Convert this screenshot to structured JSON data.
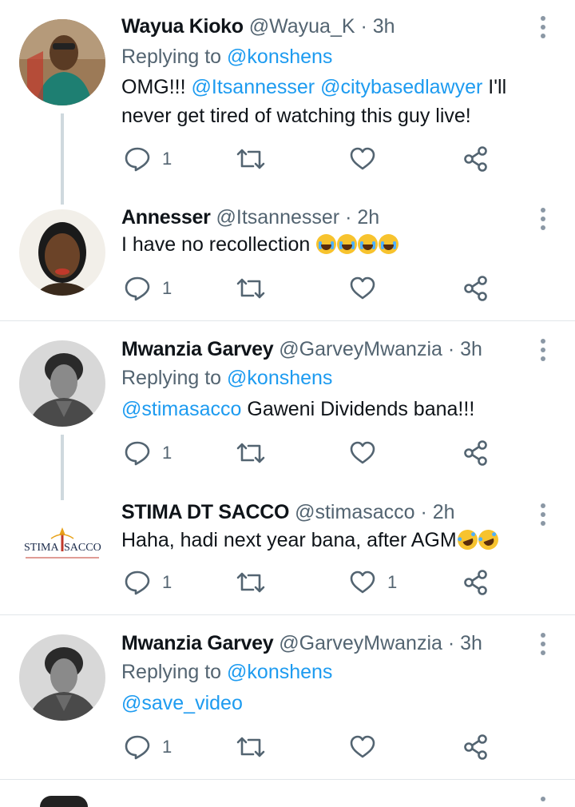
{
  "tweets": [
    {
      "name": "Wayua Kioko",
      "handle": "@Wayua_K",
      "dot": "·",
      "time": "3h",
      "replying_prefix": "Replying to",
      "replying_to": "@konshens",
      "body_mention1": "@Itsannesser",
      "body_mention2": "@citybasedlawyer",
      "body_pre": "OMG!!!",
      "body_post": "I'll never get tired of watching this guy live!",
      "reply_count": "1"
    },
    {
      "name": "Annesser",
      "handle": "@Itsannesser",
      "dot": "·",
      "time": "2h",
      "body": "I have no recollection",
      "reply_count": "1"
    },
    {
      "name": "Mwanzia Garvey",
      "handle": "@GarveyMwanzia",
      "dot": "·",
      "time": "3h",
      "replying_prefix": "Replying to",
      "replying_to": "@konshens",
      "body_mention": "@stimasacco",
      "body_post": "Gaweni Dividends bana!!!",
      "reply_count": "1"
    },
    {
      "name": "STIMA DT SACCO",
      "handle": "@stimasacco",
      "dot": "·",
      "time": "2h",
      "body": "Haha, hadi next year bana, after AGM",
      "reply_count": "1",
      "like_count": "1",
      "logo_text_left": "STIMA",
      "logo_text_right": "SACCO"
    },
    {
      "name": "Mwanzia Garvey",
      "handle": "@GarveyMwanzia",
      "dot": "·",
      "time": "3h",
      "replying_prefix": "Replying to",
      "replying_to": "@konshens",
      "body_mention": "@save_video",
      "reply_count": "1"
    }
  ],
  "icons": {
    "reply": "reply-icon",
    "retweet": "retweet-icon",
    "like": "heart-icon",
    "share": "share-icon",
    "more": "more-options-icon"
  },
  "colors": {
    "mention": "#1d9bf0",
    "secondary": "#536471",
    "thread_line": "#cfd9de"
  }
}
